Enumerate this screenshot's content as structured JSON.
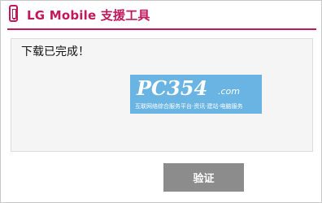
{
  "window": {
    "title": "LG Mobile 支援工具"
  },
  "dialog": {
    "message": "下载已完成！"
  },
  "watermark": {
    "logo": "PC354",
    "domain": ".com",
    "tagline": "互联网络综合服务平台·资讯·建站·电脑服务"
  },
  "actions": {
    "confirm_label": "验证"
  },
  "colors": {
    "accent": "#c2185b",
    "button": "#8c8c8c",
    "panel": "#f5f5f5"
  },
  "icons": {
    "app": "mobile-phone-icon"
  }
}
